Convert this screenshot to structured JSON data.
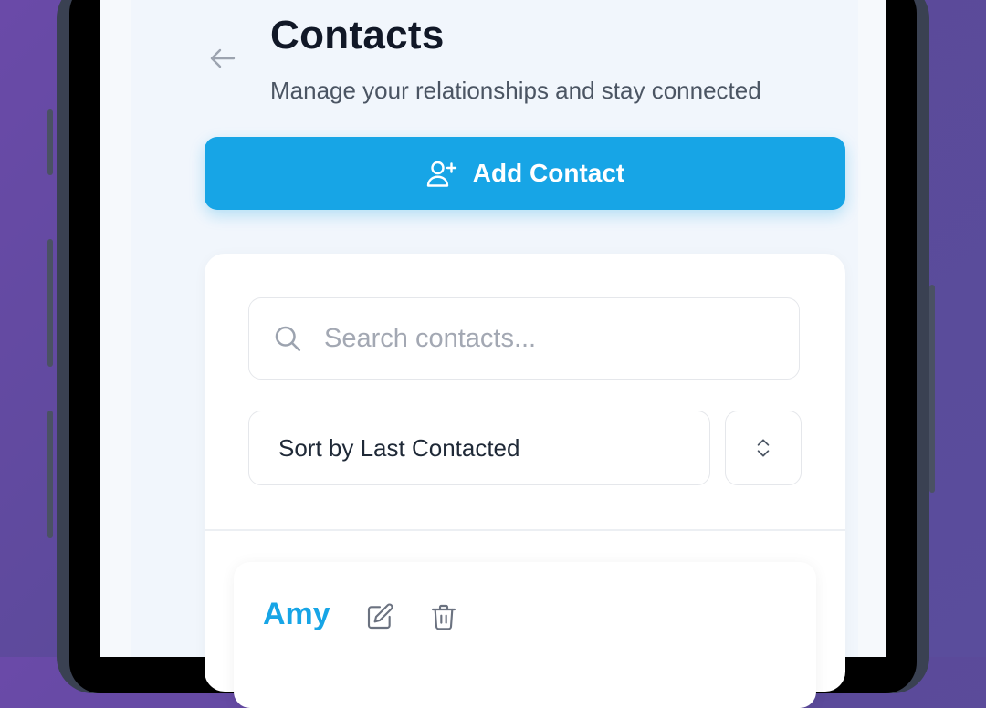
{
  "header": {
    "title": "Contacts",
    "subtitle": "Manage your relationships and stay connected"
  },
  "actions": {
    "add_contact_label": "Add Contact"
  },
  "search": {
    "placeholder": "Search contacts...",
    "value": ""
  },
  "sort": {
    "selected": "Sort by Last Contacted"
  },
  "contacts": [
    {
      "name": "Amy"
    }
  ],
  "icons": {
    "back": "arrow-left-icon",
    "add": "user-plus-icon",
    "search": "search-icon",
    "sort_toggle": "chevron-up-down-icon",
    "edit": "edit-icon",
    "delete": "trash-icon"
  },
  "colors": {
    "accent": "#17a5e6",
    "background": "#5b4a9a",
    "title": "#111827"
  }
}
